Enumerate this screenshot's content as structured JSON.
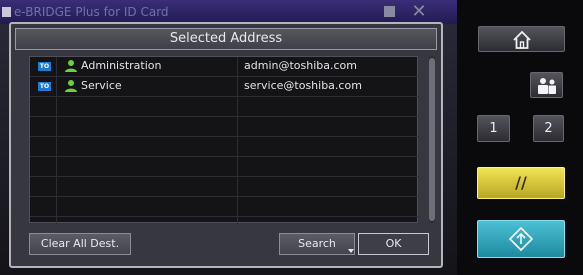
{
  "background_window": {
    "title": "e-BRIDGE Plus for ID Card"
  },
  "dialog": {
    "title": "Selected Address",
    "recipients": [
      {
        "type": "TO",
        "name": "Administration",
        "email": "admin@toshiba.com",
        "icon": "person-icon"
      },
      {
        "type": "TO",
        "name": "Service",
        "email": "service@toshiba.com",
        "icon": "person-icon"
      }
    ],
    "empty_rows": 6,
    "buttons": {
      "clear_all": "Clear All Dest.",
      "search": "Search",
      "ok": "OK"
    }
  },
  "hardware_panel": {
    "home_icon": "home-icon",
    "contacts_icon": "contacts-icon",
    "key_1": "1",
    "key_2": "2",
    "clear_key": "//",
    "start_icon": "start-diamond-icon"
  },
  "colors": {
    "to_badge": "#1e7bd0",
    "person_icon": "#6ad13a",
    "clear_key": "#e6d43c",
    "start_key": "#36a8bc"
  }
}
